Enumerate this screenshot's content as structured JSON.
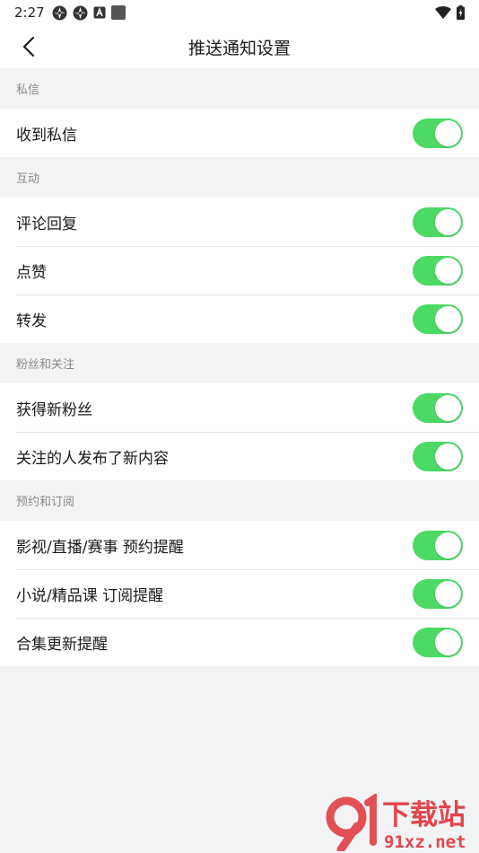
{
  "status_bar": {
    "time": "2:27"
  },
  "header": {
    "title": "推送通知设置"
  },
  "sections": [
    {
      "title": "私信",
      "items": [
        {
          "label": "收到私信",
          "enabled": true
        }
      ]
    },
    {
      "title": "互动",
      "items": [
        {
          "label": "评论回复",
          "enabled": true
        },
        {
          "label": "点赞",
          "enabled": true
        },
        {
          "label": "转发",
          "enabled": true
        }
      ]
    },
    {
      "title": "粉丝和关注",
      "items": [
        {
          "label": "获得新粉丝",
          "enabled": true
        },
        {
          "label": "关注的人发布了新内容",
          "enabled": true
        }
      ]
    },
    {
      "title": "预约和订阅",
      "items": [
        {
          "label": "影视/直播/赛事 预约提醒",
          "enabled": true
        },
        {
          "label": "小说/精品课 订阅提醒",
          "enabled": true
        },
        {
          "label": "合集更新提醒",
          "enabled": true
        }
      ]
    }
  ],
  "watermark": {
    "brand": "下载站",
    "domain": "91xz.net"
  },
  "colors": {
    "toggle_on": "#4cd964",
    "background": "#f2f3f5",
    "watermark": "#e0343a"
  }
}
